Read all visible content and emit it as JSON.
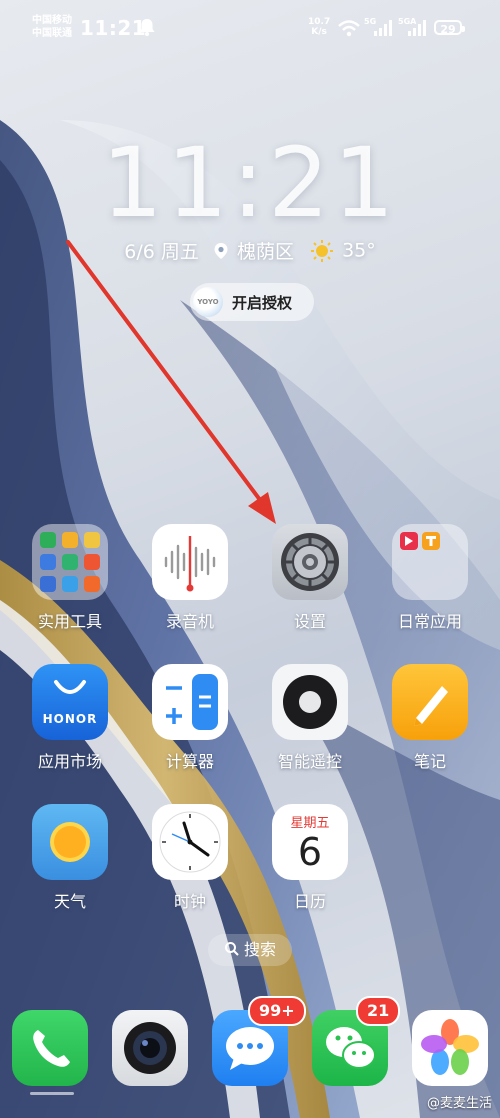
{
  "status_bar": {
    "carrier1": "中国移动",
    "carrier2": "中国联通",
    "time": "11:21",
    "net_speed_value": "10.7",
    "net_speed_unit": "K/s",
    "sim1_type": "5G",
    "sim2_type": "5GA",
    "battery": "29"
  },
  "lock_clock": {
    "time": "11:21",
    "date": "6/6 周五",
    "location": "槐荫区",
    "temperature": "35°"
  },
  "auth_chip": {
    "logo_text": "YOYO",
    "label": "开启授权"
  },
  "apps": [
    {
      "label": "实用工具"
    },
    {
      "label": "录音机"
    },
    {
      "label": "设置"
    },
    {
      "label": "日常应用"
    },
    {
      "label": "应用市场",
      "brand": "HONOR"
    },
    {
      "label": "计算器"
    },
    {
      "label": "智能遥控"
    },
    {
      "label": "笔记"
    },
    {
      "label": "天气"
    },
    {
      "label": "时钟"
    },
    {
      "label": "日历",
      "weekday": "星期五",
      "day": "6"
    }
  ],
  "search": {
    "label": "搜索"
  },
  "dock": {
    "messages_badge": "99+",
    "wechat_badge": "21"
  },
  "watermark": "@麦麦生活",
  "colors": {
    "arrow": "#e0362c",
    "badge": "#f03b34",
    "phone_green": "#35c755"
  }
}
